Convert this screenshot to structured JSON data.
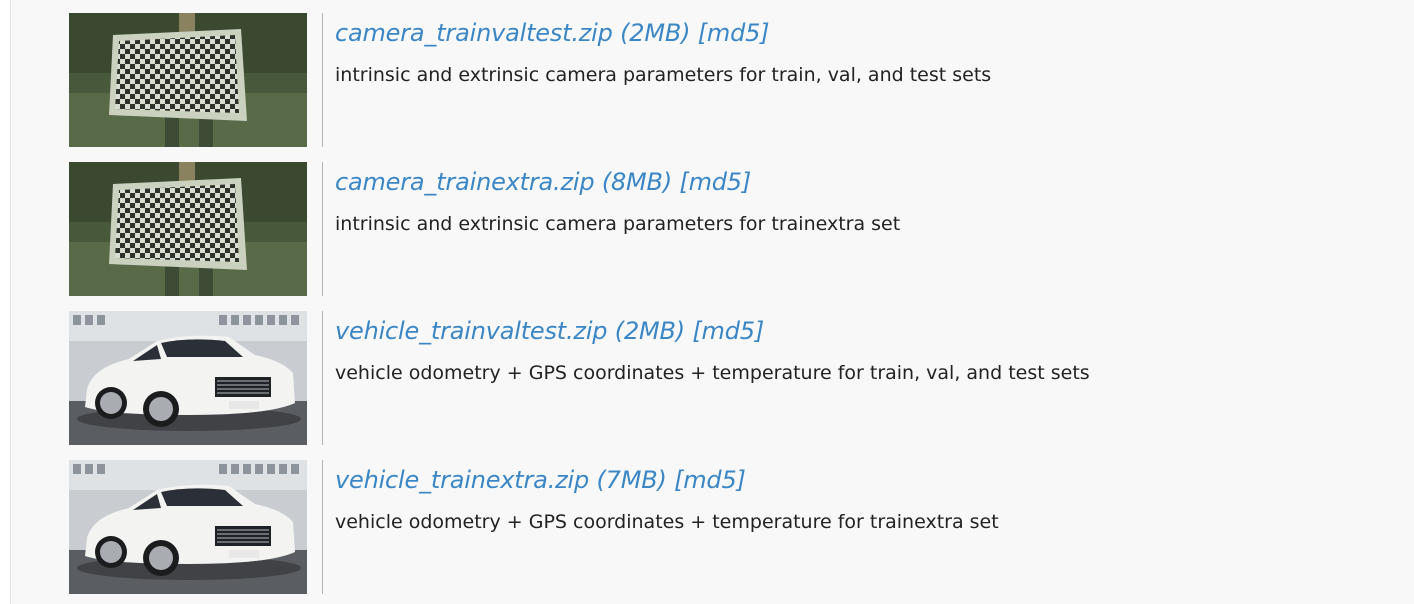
{
  "downloads": [
    {
      "thumbnail": "checkerboard-calibration-photo",
      "name": "camera_trainvaltest.zip",
      "size": "(2MB)",
      "md5": "[md5]",
      "description": "intrinsic and extrinsic camera parameters for train, val, and test sets"
    },
    {
      "thumbnail": "checkerboard-calibration-photo",
      "name": "camera_trainextra.zip",
      "size": "(8MB)",
      "md5": "[md5]",
      "description": "intrinsic and extrinsic camera parameters for trainextra set"
    },
    {
      "thumbnail": "white-sedan-photo",
      "name": "vehicle_trainvaltest.zip",
      "size": "(2MB)",
      "md5": "[md5]",
      "description": "vehicle odometry + GPS coordinates + temperature for train, val, and test sets"
    },
    {
      "thumbnail": "white-sedan-photo",
      "name": "vehicle_trainextra.zip",
      "size": "(7MB)",
      "md5": "[md5]",
      "description": "vehicle odometry + GPS coordinates + temperature for trainextra set"
    }
  ],
  "colors": {
    "link": "#3b87c5",
    "text": "#222222",
    "background": "#f8f8f8"
  }
}
